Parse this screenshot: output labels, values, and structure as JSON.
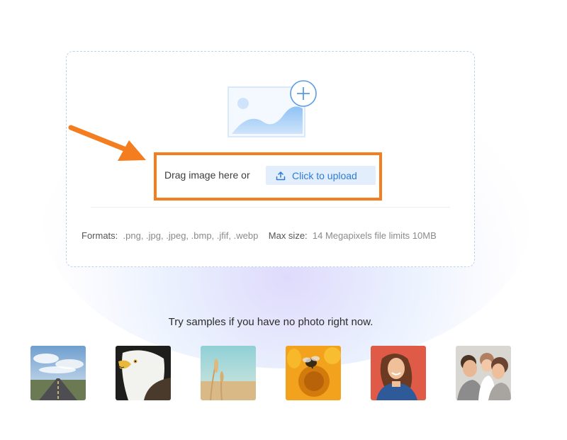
{
  "upload": {
    "drag_text": "Drag image here or",
    "button_label": "Click to upload"
  },
  "info": {
    "formats_label": "Formats:",
    "formats_value": ".png, .jpg, .jpeg, .bmp, .jfif, .webp",
    "maxsize_label": "Max size:",
    "maxsize_value": "14 Megapixels file limits 10MB"
  },
  "samples": {
    "title": "Try samples if you have no photo right now.",
    "items": [
      {
        "icon": "road-photo"
      },
      {
        "icon": "eagle-photo"
      },
      {
        "icon": "wheat-photo"
      },
      {
        "icon": "bee-sunflower-photo"
      },
      {
        "icon": "smiling-woman-photo"
      },
      {
        "icon": "family-photo"
      }
    ]
  },
  "colors": {
    "accent": "#2d7bd6",
    "highlight": "#f47d20",
    "button_bg": "#e2eefc"
  }
}
